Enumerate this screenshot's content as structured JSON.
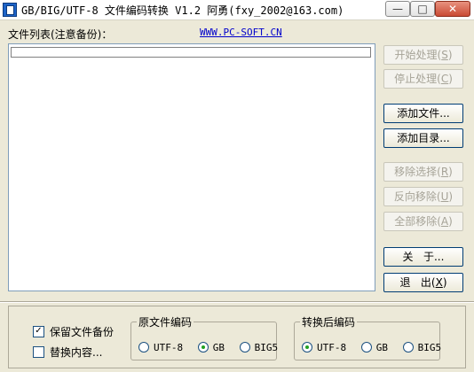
{
  "window": {
    "title": "GB/BIG/UTF-8 文件编码转换 V1.2  阿勇(fxy_2002@163.com)",
    "min_glyph": "—",
    "max_glyph": "□",
    "close_glyph": "✕"
  },
  "header": {
    "list_label": "文件列表(注意备份)：",
    "link_text": "WWW.PC-SOFT.CN"
  },
  "buttons": {
    "start": {
      "text": "开始处理",
      "hotkey": "S",
      "enabled": false
    },
    "stop": {
      "text": "停止处理",
      "hotkey": "C",
      "enabled": false
    },
    "add_file": {
      "text": "添加文件..."
    },
    "add_dir": {
      "text": "添加目录..."
    },
    "remove_selected": {
      "text": "移除选择",
      "hotkey": "R",
      "enabled": false
    },
    "remove_reverse": {
      "text": "反向移除",
      "hotkey": "U",
      "enabled": false
    },
    "remove_all": {
      "text": "全部移除",
      "hotkey": "A",
      "enabled": false
    },
    "about": {
      "text": "关   于..."
    },
    "exit": {
      "text": "退   出",
      "hotkey": "X"
    }
  },
  "options": {
    "keep_backup": {
      "label": "保留文件备份",
      "checked": true,
      "mark": "✓"
    },
    "replace_content": {
      "label": "替换内容...",
      "checked": false
    }
  },
  "source_encoding": {
    "title": "原文件编码",
    "options": [
      "UTF-8",
      "GB",
      "BIG5"
    ],
    "selected": "GB"
  },
  "target_encoding": {
    "title": "转换后编码",
    "options": [
      "UTF-8",
      "GB",
      "BIG5"
    ],
    "selected": "UTF-8"
  }
}
